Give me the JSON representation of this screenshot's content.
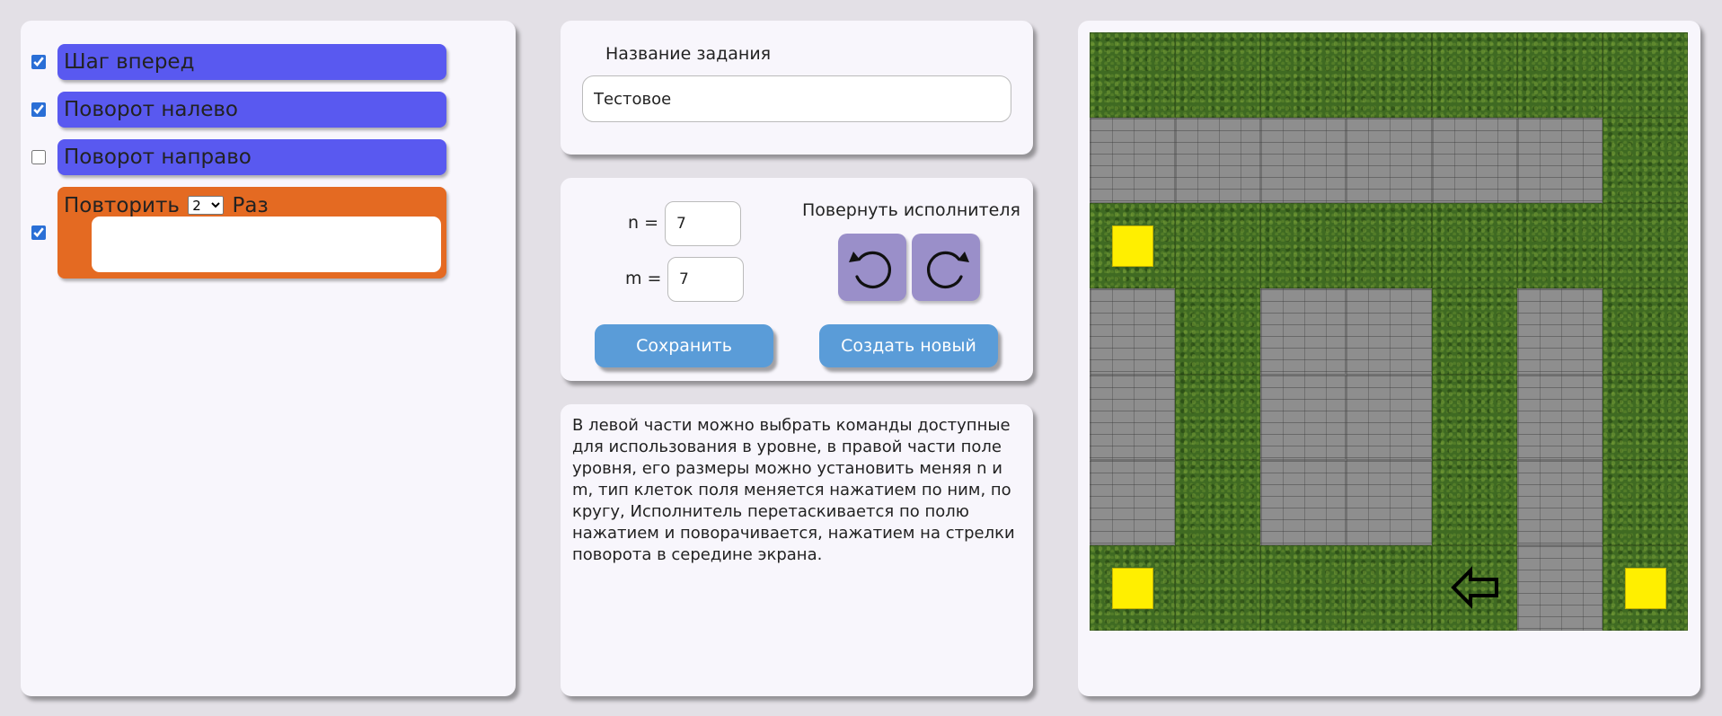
{
  "commands": [
    {
      "label": "Шаг вперед",
      "checked": true
    },
    {
      "label": "Поворот налево",
      "checked": true
    },
    {
      "label": "Поворот направо",
      "checked": false
    }
  ],
  "repeat": {
    "prefix": "Повторить",
    "count": "2",
    "suffix": "Раз",
    "checked": true,
    "options": [
      "2"
    ]
  },
  "task": {
    "name_label": "Название задания",
    "name_value": "Тестовое"
  },
  "settings": {
    "n_label": "n =",
    "n_value": "7",
    "m_label": "m =",
    "m_value": "7",
    "rotate_label": "Повернуть исполнителя",
    "rotate_left_icon": "rotate-counterclockwise-icon",
    "rotate_right_icon": "rotate-clockwise-icon",
    "save_label": "Сохранить",
    "create_label": "Создать новый"
  },
  "help_text": "В левой части можно выбрать команды доступные для использования в уровне, в правой части поле уровня, его размеры можно установить меняя n и m, тип клеток поля меняется нажатием по ним, по кругу, Исполнитель перетаскивается по полю нажатием и поворачивается, нажатием на стрелки поворота в середине экрана.",
  "field": {
    "rows": 7,
    "cols": 7,
    "cells": [
      [
        "grass",
        "grass",
        "grass",
        "grass",
        "grass",
        "grass",
        "grass"
      ],
      [
        "stone",
        "stone",
        "stone",
        "stone",
        "stone",
        "stone",
        "grass"
      ],
      [
        "grass",
        "grass",
        "grass",
        "grass",
        "grass",
        "grass",
        "grass"
      ],
      [
        "stone",
        "grass",
        "stone",
        "stone",
        "grass",
        "stone",
        "grass"
      ],
      [
        "stone",
        "grass",
        "stone",
        "stone",
        "grass",
        "stone",
        "grass"
      ],
      [
        "stone",
        "grass",
        "stone",
        "stone",
        "grass",
        "stone",
        "grass"
      ],
      [
        "grass",
        "grass",
        "grass",
        "grass",
        "grass",
        "stone",
        "grass"
      ]
    ],
    "goals": [
      {
        "row": 2,
        "col": 0
      },
      {
        "row": 6,
        "col": 0
      },
      {
        "row": 6,
        "col": 6
      }
    ],
    "executor": {
      "row": 6,
      "col": 4,
      "direction": "left",
      "icon": "arrow-left-icon"
    },
    "colors": {
      "goal": "#ffef00",
      "grass": "#3f6a22",
      "stone": "#8e8e8e"
    }
  },
  "colors": {
    "command_block": "#5959f0",
    "repeat_block": "#e46a22",
    "action_button": "#5a9cd8",
    "rotate_button": "#9a8fc9"
  }
}
